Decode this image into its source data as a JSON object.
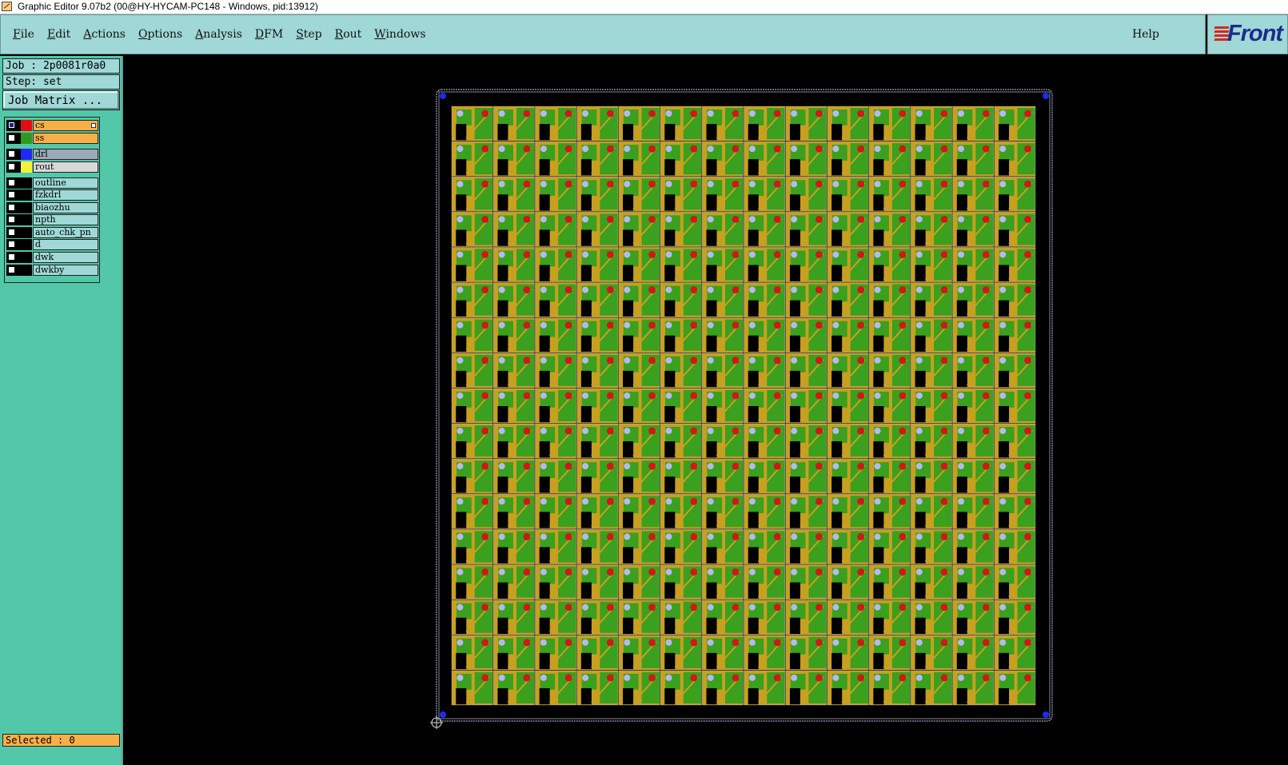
{
  "window": {
    "title": "Graphic Editor 9.07b2 (00@HY-HYCAM-PC148 - Windows, pid:13912)"
  },
  "menu": {
    "items": [
      "File",
      "Edit",
      "Actions",
      "Options",
      "Analysis",
      "DFM",
      "Step",
      "Rout",
      "Windows"
    ],
    "help": "Help"
  },
  "logo": {
    "text": "Front"
  },
  "job": {
    "label": "Job : 2p0081r0a0",
    "step": "Step: set"
  },
  "job_matrix": {
    "label": "Job Matrix ..."
  },
  "layers": [
    {
      "name": "cs",
      "color": "#e01010",
      "state": "work",
      "bg": "#f7b048",
      "checked": true
    },
    {
      "name": "ss",
      "color": "#2e9a1e",
      "state": "board",
      "bg": "#f7b048",
      "checked": false
    },
    {
      "name": "drl",
      "color": "#1f2af0",
      "state": "board",
      "bg": "#9aaab8",
      "checked": false
    },
    {
      "name": "rout",
      "color": "#f2f23a",
      "state": "board",
      "bg": "#d8d8d8",
      "checked": false
    },
    {
      "name": "outline",
      "color": "#000000",
      "state": "misc",
      "bg": "#9fd8d6",
      "checked": false
    },
    {
      "name": "fzkdrl",
      "color": "#000000",
      "state": "misc",
      "bg": "#9fd8d6",
      "checked": false
    },
    {
      "name": "biaozhu",
      "color": "#000000",
      "state": "misc",
      "bg": "#9fd8d6",
      "checked": false
    },
    {
      "name": "npth",
      "color": "#000000",
      "state": "misc",
      "bg": "#9fd8d6",
      "checked": false
    },
    {
      "name": "auto_chk_pn",
      "color": "#000000",
      "state": "misc",
      "bg": "#9fd8d6",
      "checked": false
    },
    {
      "name": "d",
      "color": "#000000",
      "state": "misc",
      "bg": "#9fd8d6",
      "checked": false
    },
    {
      "name": "dwk",
      "color": "#000000",
      "state": "misc",
      "bg": "#9fd8d6",
      "checked": false
    },
    {
      "name": "dwkby",
      "color": "#000000",
      "state": "misc",
      "bg": "#9fd8d6",
      "checked": false
    }
  ],
  "status": {
    "selected": "Selected : 0"
  },
  "board": {
    "columns": 14,
    "rows": 17,
    "unit_colors": {
      "copper": "#c8a020",
      "mask": "#3aa01e",
      "pad": "#d01818",
      "hole": "#b8b8f0"
    }
  }
}
